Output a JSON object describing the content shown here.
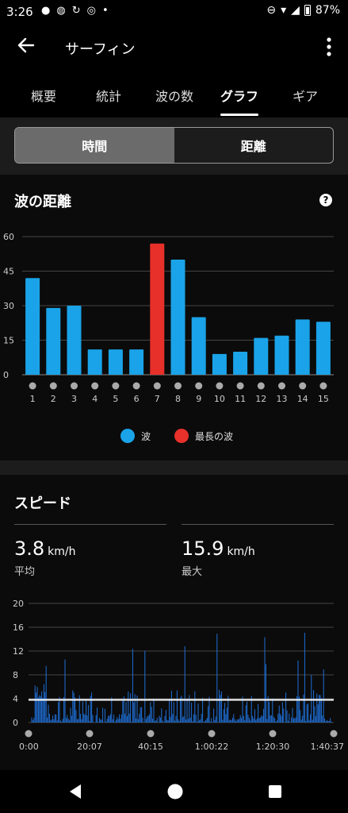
{
  "status_bar": {
    "time": "3:26",
    "battery": "87%"
  },
  "app_bar": {
    "title": "サーフィン"
  },
  "tabs": [
    {
      "label": "概要",
      "active": false
    },
    {
      "label": "統計",
      "active": false
    },
    {
      "label": "波の数",
      "active": false
    },
    {
      "label": "グラフ",
      "active": true
    },
    {
      "label": "ギア",
      "active": false
    }
  ],
  "segment": {
    "time_label": "時間",
    "distance_label": "距離",
    "selected": "時間"
  },
  "wave_distance": {
    "title": "波の距離",
    "help": "?",
    "legend": [
      {
        "label": "波",
        "color": "#1aa3e8"
      },
      {
        "label": "最長の波",
        "color": "#e8302a"
      }
    ]
  },
  "speed": {
    "title": "スピード",
    "avg_value": "3.8",
    "avg_unit": "km/h",
    "avg_label": "平均",
    "max_value": "15.9",
    "max_unit": "km/h",
    "max_label": "最大"
  },
  "chart_data": [
    {
      "type": "bar",
      "categories": [
        "1",
        "2",
        "3",
        "4",
        "5",
        "6",
        "7",
        "8",
        "9",
        "10",
        "11",
        "12",
        "13",
        "14",
        "15"
      ],
      "values": [
        42,
        29,
        30,
        11,
        11,
        11,
        57,
        50,
        25,
        9,
        10,
        16,
        17,
        24,
        23
      ],
      "highlight_index": 6,
      "colors": {
        "bar": "#1aa3e8",
        "highlight": "#e8302a"
      },
      "yticks": [
        0,
        15,
        30,
        45,
        60
      ],
      "ylim": [
        0,
        60
      ],
      "grid": true,
      "legend": "bottom"
    },
    {
      "type": "bar",
      "x_ticks": [
        "0:00",
        "20:07",
        "40:15",
        "1:00:22",
        "1:20:30",
        "1:40:37"
      ],
      "yticks": [
        0,
        4,
        8,
        12,
        16,
        20
      ],
      "ylim": [
        0,
        20
      ],
      "average_line": 3.8,
      "max": 15.9,
      "grid": true,
      "colors": {
        "bar": "#1f6fd6",
        "average": "#ffffff"
      }
    }
  ]
}
